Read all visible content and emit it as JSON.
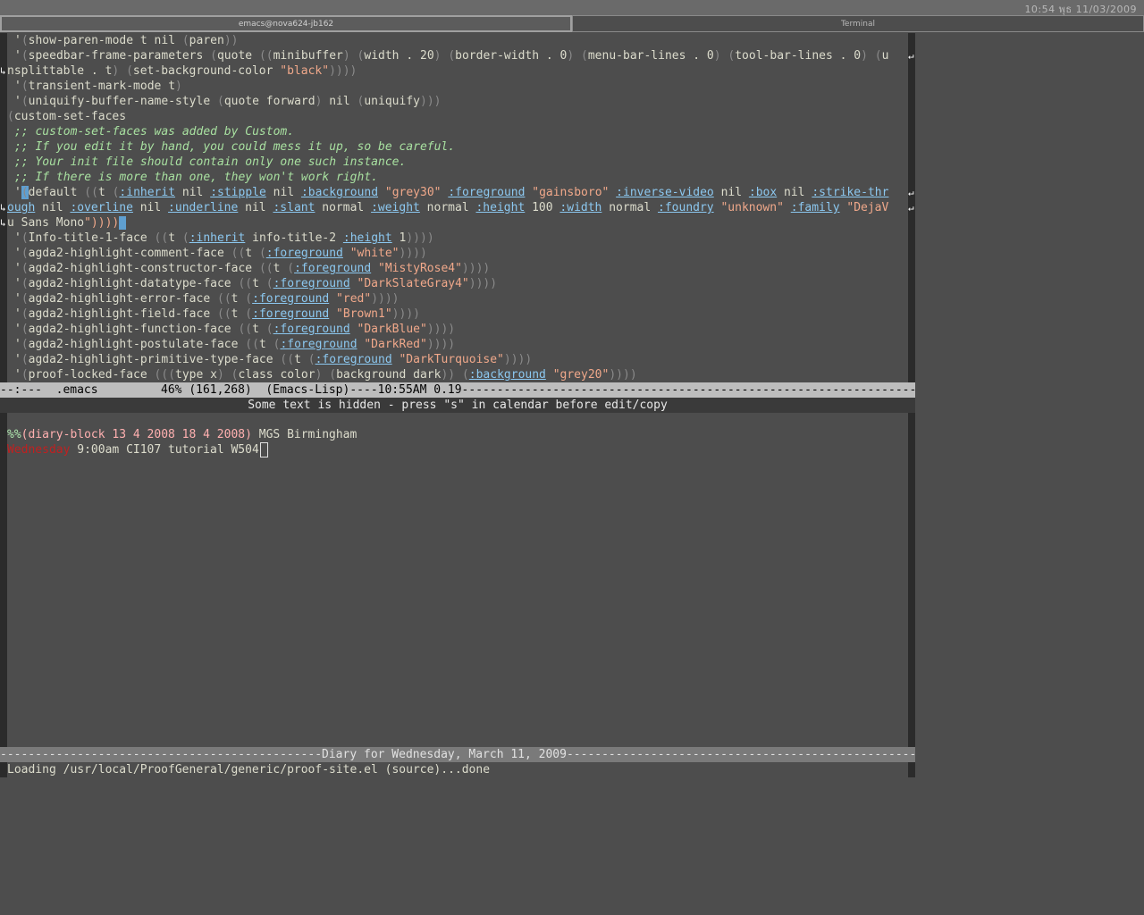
{
  "topbar": {
    "clock": "10:54 พุธ 11/03/2009"
  },
  "window_tabs": [
    {
      "label": "emacs@nova624-jb162",
      "active": true
    },
    {
      "label": "Terminal",
      "active": false
    }
  ],
  "editor": {
    "lines": [
      "'(show-paren-mode t nil (paren))",
      "'(speedbar-frame-parameters (quote ((minibuffer) (width . 20) (border-width . 0) (menu-bar-lines . 0) (tool-bar-lines . 0) (u",
      "nsplittable . t) (set-background-color \"black\"))))",
      "'(transient-mark-mode t)",
      "'(uniquify-buffer-name-style (quote forward) nil (uniquify)))",
      "(custom-set-faces",
      ";; custom-set-faces was added by Custom.",
      ";; If you edit it by hand, you could mess it up, so be careful.",
      ";; Your init file should contain only one such instance.",
      ";; If there is more than one, they won't work right.",
      "'(default ((t (:inherit nil :stipple nil :background \"grey30\" :foreground \"gainsboro\" :inverse-video nil :box nil :strike-thr",
      "ough nil :overline nil :underline nil :slant normal :weight normal :height 100 :width normal :foundry \"unknown\" :family \"DejaV",
      "u Sans Mono\"))))",
      "'(Info-title-1-face ((t (:inherit info-title-2 :height 1))))",
      "'(agda2-highlight-comment-face ((t (:foreground \"white\"))))",
      "'(agda2-highlight-constructor-face ((t (:foreground \"MistyRose4\"))))",
      "'(agda2-highlight-datatype-face ((t (:foreground \"DarkSlateGray4\"))))",
      "'(agda2-highlight-error-face ((t (:foreground \"red\"))))",
      "'(agda2-highlight-field-face ((t (:foreground \"Brown1\"))))",
      "'(agda2-highlight-function-face ((t (:foreground \"DarkBlue\"))))",
      "'(agda2-highlight-postulate-face ((t (:foreground \"DarkRed\"))))",
      "'(agda2-highlight-primitive-type-face ((t (:foreground \"DarkTurquoise\"))))",
      "'(proof-locked-face (((type x) (class color) (background dark)) (:background \"grey20\"))))"
    ]
  },
  "modeline_top": "--:---  .emacs         46% (161,268)  (Emacs-Lisp)----10:55AM 0.19---------------------------------------------------------------------------------------",
  "diary": {
    "header": "Some text is hidden - press \"s\" in calendar before edit/copy",
    "entry1_marker": "%%",
    "entry1_sexp": "(diary-block 13 4 2008 18 4 2008)",
    "entry1_text": " MGS Birmingham",
    "entry2_day": "Wednesday",
    "entry2_text": " 9:00am CI107 tutorial W504"
  },
  "modeline_bottom": "----------------------------------------------Diary for Wednesday, March 11, 2009-----------------------------------------------------------",
  "echo_area": "Loading /usr/local/ProofGeneral/generic/proof-site.el (source)...done",
  "colors": {
    "background": "#4d4d4d",
    "keyword": "#8cc8f0",
    "string": "#f0a88a",
    "comment": "#a8e0a0",
    "cursor": "#5f9fd0"
  }
}
